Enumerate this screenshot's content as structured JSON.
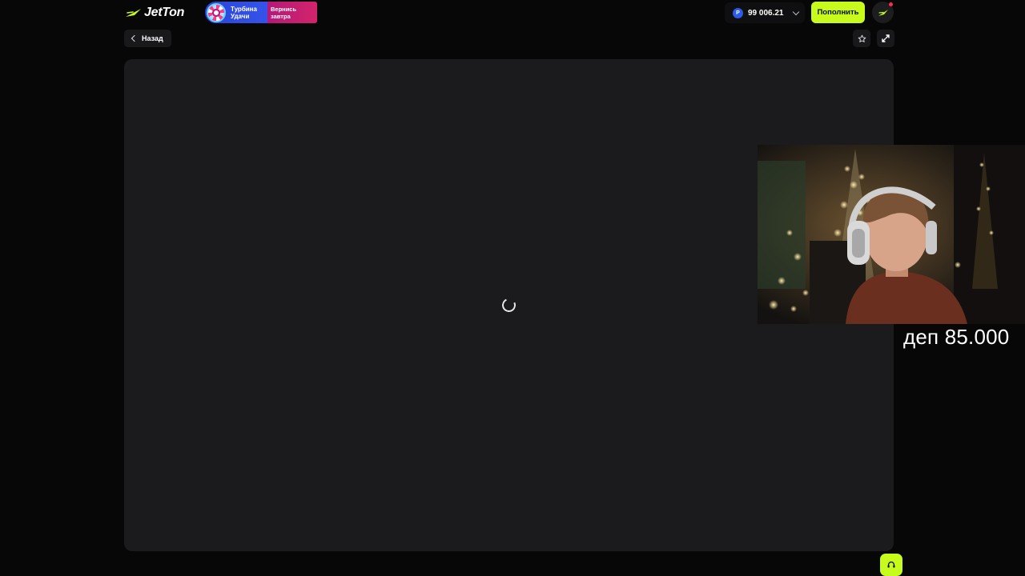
{
  "header": {
    "logo_text": "JetTon",
    "promo": {
      "title": "Турбина Удачи",
      "subtitle": "Вернись завтра"
    },
    "balance": {
      "currency_symbol": "Р",
      "value": "99 006.21"
    },
    "topup_label": "Пополнить"
  },
  "toolbar": {
    "back_label": "Назад"
  },
  "game": {
    "state": "loading"
  },
  "stream_overlay": {
    "caption": "деп 85.000"
  },
  "colors": {
    "accent": "#c6fb1b",
    "background": "#070708",
    "panel": "#1b1b1d",
    "promo_blue": "#3553ea",
    "promo_pink": "#c91f73",
    "coin_blue": "#2b5be8"
  },
  "icons": {
    "logo": "jet-plane-logo-icon",
    "promo": "lucky-wheel-icon",
    "coin": "ruble-coin-icon",
    "dropdown": "chevron-down-icon",
    "profile": "jet-plane-avatar-icon",
    "back": "chevron-left-icon",
    "favorite": "star-icon",
    "fullscreen": "expand-icon",
    "loading": "spinner-icon",
    "support": "headset-icon"
  }
}
